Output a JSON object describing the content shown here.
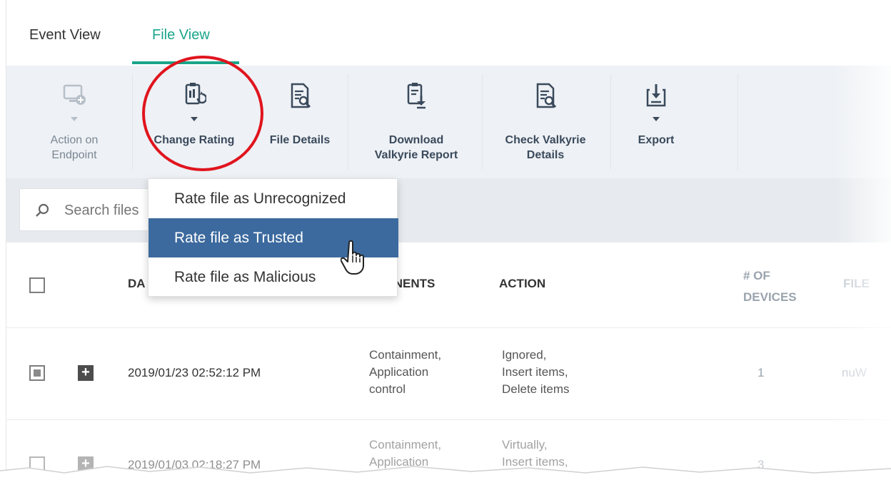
{
  "tabs": [
    {
      "label": "Event View",
      "active": false
    },
    {
      "label": "File View",
      "active": true
    }
  ],
  "toolbar": {
    "action_on_endpoint": "Action on\nEndpoint",
    "change_rating": "Change Rating",
    "file_details": "File Details",
    "download_valkyrie": "Download\nValkyrie Report",
    "check_valkyrie": "Check Valkyrie\nDetails",
    "export": "Export"
  },
  "search": {
    "placeholder": "Search files"
  },
  "menu": {
    "items": [
      {
        "label": "Rate file as Unrecognized",
        "selected": false
      },
      {
        "label": "Rate file as Trusted",
        "selected": true
      },
      {
        "label": "Rate file as Malicious",
        "selected": false
      }
    ]
  },
  "table": {
    "headers": {
      "date": "DA",
      "components": "MPONENTS",
      "action": "ACTION",
      "devices": "# OF\nDEVICES",
      "file": "FILE"
    },
    "rows": [
      {
        "date": "2019/01/23 02:52:12 PM",
        "components": "Containment,\nApplication\ncontrol",
        "action": "Ignored,\nInsert items,\nDelete items",
        "devices": "1",
        "file": "nuW"
      },
      {
        "date": "2019/01/03 02:18:27 PM",
        "components": "Containment,\nApplication",
        "action": "Virtually,\nInsert items,",
        "devices": "3",
        "file": ""
      }
    ]
  },
  "colors": {
    "accent": "#1aa58a",
    "menu_selected": "#3c6a9e",
    "highlight_circle": "#e0141d"
  }
}
